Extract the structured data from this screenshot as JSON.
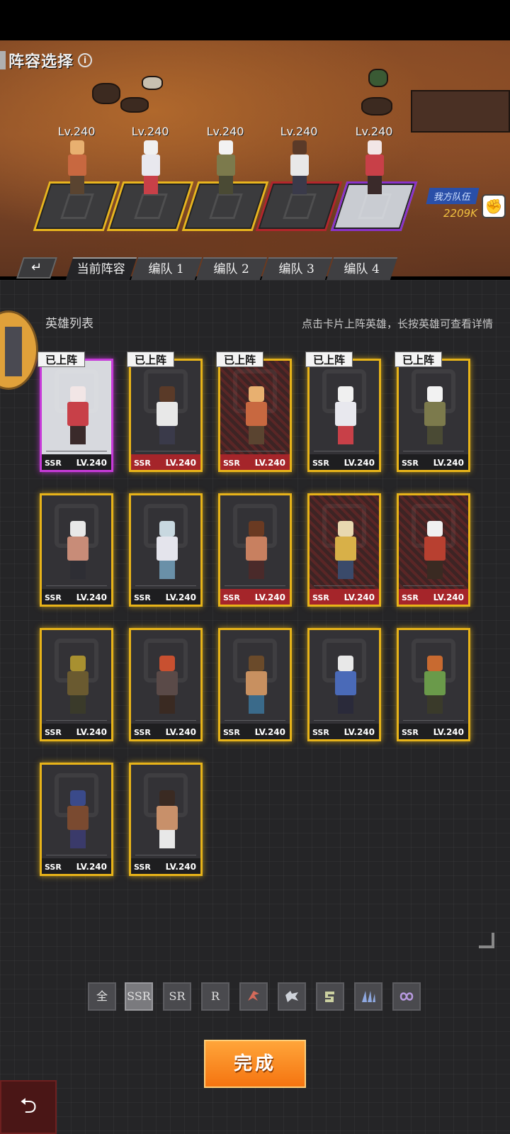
{
  "header": {
    "title": "阵容选择",
    "info_icon": "i",
    "power_label": "我方队伍",
    "power_value": "2209K",
    "power_icon": "fist-icon"
  },
  "formation": [
    {
      "level": "Lv.240",
      "pad": "gold",
      "head": "#e8b070",
      "body": "#c86840",
      "legs": "#5a4430"
    },
    {
      "level": "Lv.240",
      "pad": "gold",
      "head": "#f0f0f0",
      "body": "#e8e8ee",
      "legs": "#c84048"
    },
    {
      "level": "Lv.240",
      "pad": "gold",
      "head": "#f2f2f2",
      "body": "#7c7a4c",
      "legs": "#4a4a34"
    },
    {
      "level": "Lv.240",
      "pad": "red",
      "head": "#5a3a28",
      "body": "#e8e8e8",
      "legs": "#3a3a4a"
    },
    {
      "level": "Lv.240",
      "pad": "purple",
      "head": "#f2e6e6",
      "body": "#c84048",
      "legs": "#3a2a2a"
    }
  ],
  "tabs": {
    "back": "↵",
    "items": [
      "当前阵容",
      "编队 1",
      "编队 2",
      "编队 3",
      "编队 4"
    ],
    "active": 0
  },
  "list": {
    "title": "英雄列表",
    "hint": "点击卡片上阵英雄，长按英雄可查看详情",
    "deployed_label": "已上阵",
    "rarity": "SSR",
    "level_text": "LV.240"
  },
  "heroes": [
    {
      "deployed": true,
      "frame": "purple",
      "foot": "dark",
      "hatch": false,
      "head": "#f2e6e6",
      "body": "#c84048",
      "legs": "#3a2a2a"
    },
    {
      "deployed": true,
      "frame": "gold",
      "foot": "red",
      "hatch": false,
      "head": "#5a3a28",
      "body": "#e8e8e8",
      "legs": "#3a3a4a"
    },
    {
      "deployed": true,
      "frame": "gold",
      "foot": "red",
      "hatch": true,
      "head": "#e8b070",
      "body": "#c86840",
      "legs": "#5a4430"
    },
    {
      "deployed": true,
      "frame": "gold",
      "foot": "dark",
      "hatch": false,
      "head": "#f0f0f0",
      "body": "#e8e8ee",
      "legs": "#c84048"
    },
    {
      "deployed": true,
      "frame": "gold",
      "foot": "dark",
      "hatch": false,
      "head": "#f2f2f2",
      "body": "#7c7a4c",
      "legs": "#4a4a34"
    },
    {
      "deployed": false,
      "frame": "gold",
      "foot": "dark",
      "hatch": false,
      "head": "#e8e8e8",
      "body": "#c88c78",
      "legs": "#2e2e34"
    },
    {
      "deployed": false,
      "frame": "gold",
      "foot": "dark",
      "hatch": false,
      "head": "#c8d8e0",
      "body": "#e4e4ec",
      "legs": "#6a90a8"
    },
    {
      "deployed": false,
      "frame": "gold",
      "foot": "red",
      "hatch": false,
      "head": "#6a3a22",
      "body": "#c88060",
      "legs": "#4a2a2a"
    },
    {
      "deployed": false,
      "frame": "gold",
      "foot": "red",
      "hatch": true,
      "head": "#e8d8b0",
      "body": "#d8b048",
      "legs": "#3a4a6a"
    },
    {
      "deployed": false,
      "frame": "gold",
      "foot": "red",
      "hatch": true,
      "head": "#f0f0f0",
      "body": "#b84030",
      "legs": "#3a2a22"
    },
    {
      "deployed": false,
      "frame": "gold",
      "foot": "dark",
      "hatch": false,
      "head": "#a89030",
      "body": "#6a5a30",
      "legs": "#3a3a2a"
    },
    {
      "deployed": false,
      "frame": "gold",
      "foot": "dark",
      "hatch": false,
      "head": "#c85030",
      "body": "#5a4a48",
      "legs": "#3a2a22"
    },
    {
      "deployed": false,
      "frame": "gold",
      "foot": "dark",
      "hatch": false,
      "head": "#6a4a2a",
      "body": "#c89060",
      "legs": "#3a6a8a"
    },
    {
      "deployed": false,
      "frame": "gold",
      "foot": "dark",
      "hatch": false,
      "head": "#e8e8e8",
      "body": "#4a6ab8",
      "legs": "#2a2a3a"
    },
    {
      "deployed": false,
      "frame": "gold",
      "foot": "dark",
      "hatch": false,
      "head": "#c86a30",
      "body": "#6a9a4a",
      "legs": "#3a3a2a"
    },
    {
      "deployed": false,
      "frame": "gold",
      "foot": "dark",
      "hatch": false,
      "head": "#3a4a8a",
      "body": "#7a4a30",
      "legs": "#3a3a6a"
    },
    {
      "deployed": false,
      "frame": "gold",
      "foot": "dark",
      "hatch": false,
      "head": "#3a2a22",
      "body": "#c8906a",
      "legs": "#e8e8e8"
    }
  ],
  "filters": [
    {
      "label": "全",
      "active": false,
      "icon": ""
    },
    {
      "label": "SSR",
      "active": true,
      "icon": ""
    },
    {
      "label": "SR",
      "active": false,
      "icon": ""
    },
    {
      "label": "R",
      "active": false,
      "icon": ""
    },
    {
      "label": "",
      "active": false,
      "icon": "claw-faction-icon"
    },
    {
      "label": "",
      "active": false,
      "icon": "wolf-faction-icon"
    },
    {
      "label": "",
      "active": false,
      "icon": "serpent-faction-icon"
    },
    {
      "label": "",
      "active": false,
      "icon": "wing-faction-icon"
    },
    {
      "label": "",
      "active": false,
      "icon": "infinity-faction-icon"
    }
  ],
  "actions": {
    "done": "完成",
    "exit_icon": "return-icon"
  },
  "colors": {
    "gold_frame": "#e7b319",
    "red_frame": "#b3262c",
    "purple_frame": "#c63ad8",
    "done_button": "#f57410"
  }
}
